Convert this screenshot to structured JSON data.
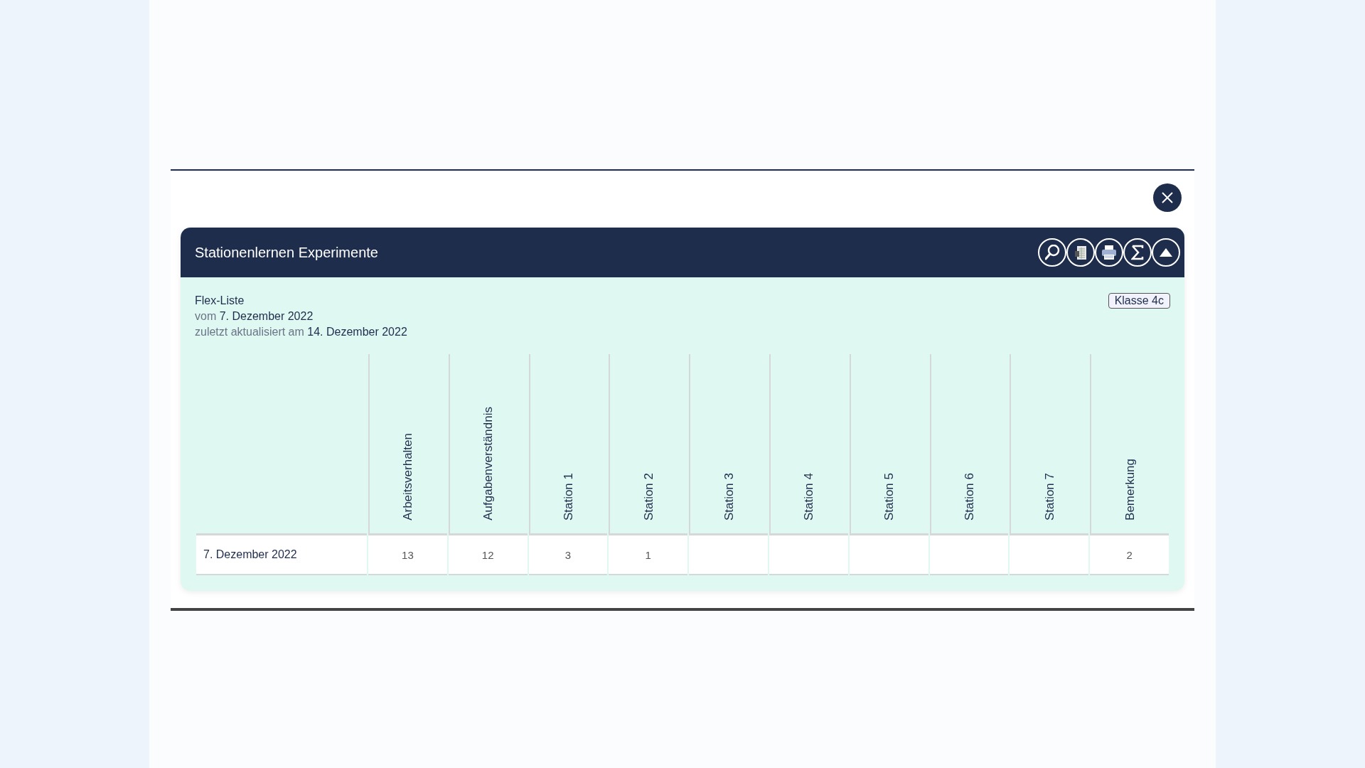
{
  "panel": {
    "title": "Stationenlernen Experimente",
    "toolbar": [
      {
        "kind": "search"
      },
      {
        "kind": "excel"
      },
      {
        "kind": "print"
      },
      {
        "kind": "sum"
      },
      {
        "kind": "collapse"
      }
    ]
  },
  "info": {
    "list_type": "Flex-Liste",
    "created": "vom **7. Dezember 2022**",
    "updated": "zuletzt aktualisiert am **14. Dezember 2022**",
    "class_tag": "Klasse 4c"
  },
  "table": {
    "columns": [
      "Arbeitsverhalten",
      "Aufgabenverständnis",
      "Station 1",
      "Station 2",
      "Station 3",
      "Station 4",
      "Station 5",
      "Station 6",
      "Station 7",
      "Bemerkung"
    ],
    "rows": [
      {
        "label": "7. Dezember 2022",
        "cells": [
          "13",
          "12",
          "3",
          "1",
          "",
          "",
          "",
          "",
          "",
          "2"
        ]
      }
    ]
  }
}
